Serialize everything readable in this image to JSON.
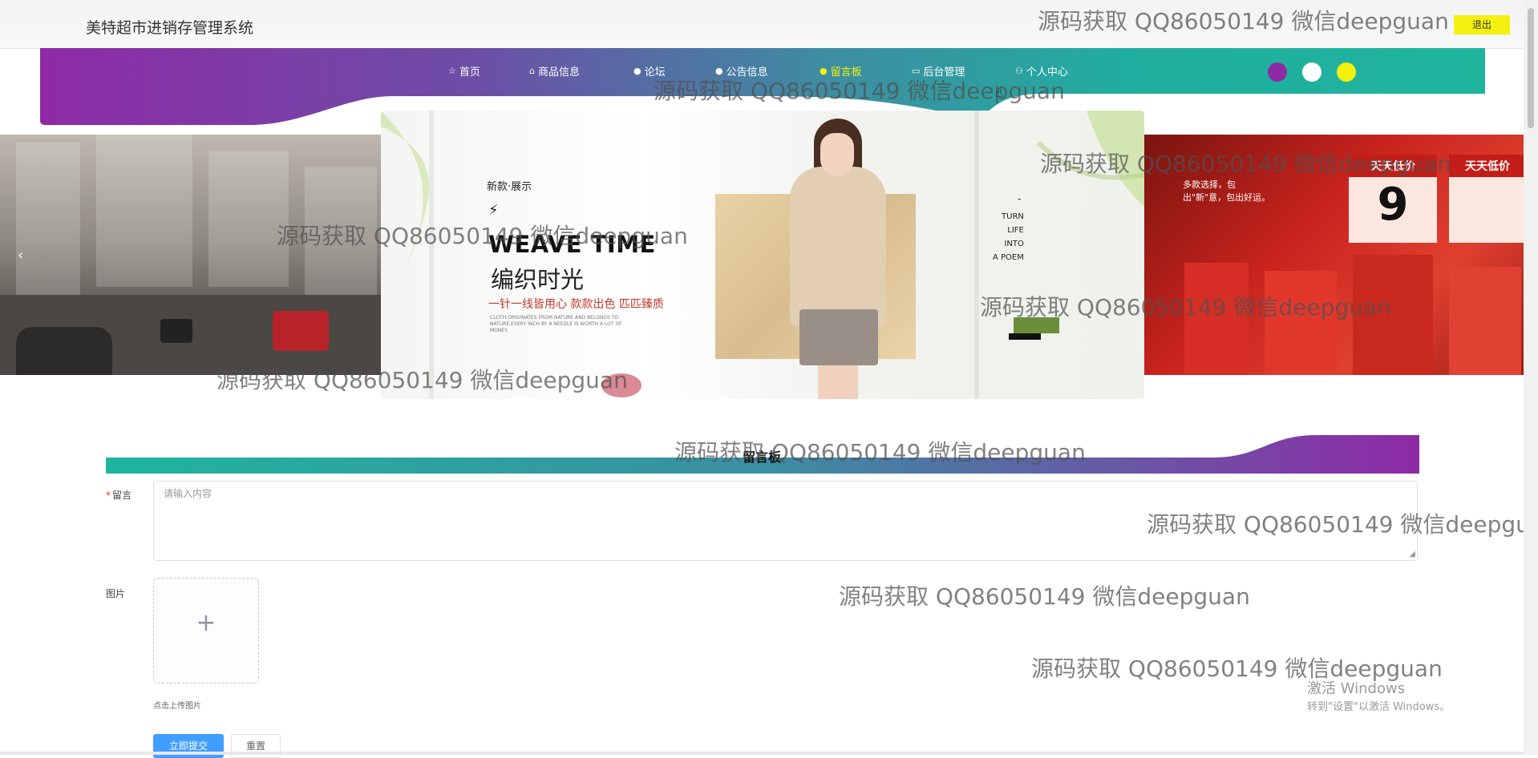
{
  "header": {
    "app_title": "美特超市进销存管理系统",
    "logout_label": "退出"
  },
  "nav": {
    "items": [
      {
        "label": "首页",
        "icon": "star-icon",
        "glyph": "☆"
      },
      {
        "label": "商品信息",
        "icon": "bag-icon",
        "glyph": "⌂"
      },
      {
        "label": "论坛",
        "icon": "info-icon",
        "glyph": "●"
      },
      {
        "label": "公告信息",
        "icon": "info-icon",
        "glyph": "●"
      },
      {
        "label": "留言板",
        "icon": "info-icon",
        "glyph": "●"
      },
      {
        "label": "后台管理",
        "icon": "briefcase-icon",
        "glyph": "▭"
      },
      {
        "label": "个人中心",
        "icon": "user-icon",
        "glyph": "⚇"
      }
    ],
    "active_item": "留言板"
  },
  "theme_swatches": [
    "#8e2aa6",
    "#ffffff",
    "#f4f010"
  ],
  "banner": {
    "kicker": "新款·展示",
    "headline": "WEAVE TIME",
    "headline_cn": "编织时光",
    "tagline": "一针一线皆用心 款款出色 匹匹臻质",
    "small_print": "CLOTH ORIGINATES FROM NATURE AND BELONGS TO NATURE.EVERY INCH BY A NEEDLE IS WORTH A LOT OF MONEY.",
    "poem_dash": "-",
    "poem_lines": [
      "TURN",
      "LIFE",
      "INTO",
      "A POEM"
    ],
    "right_slide_text_1": "天天低价",
    "right_slide_text_2": "9",
    "right_slide_text_3": "多款选择，包出\"新\"意，包出好运。",
    "prev_arrow": "‹"
  },
  "form": {
    "section_title": "留言板",
    "message_label": "留言",
    "message_placeholder": "请输入内容",
    "image_label": "图片",
    "upload_plus": "+",
    "upload_tip": "点击上传图片",
    "submit_label": "立即提交",
    "reset_label": "重置"
  },
  "watermark_text": "源码获取 QQ86050149 微信deepguan",
  "windows_notice": {
    "line1": "激活 Windows",
    "line2": "转到\"设置\"以激活 Windows。"
  },
  "colors": {
    "band_purple": "#8e2aa6",
    "band_teal": "#1fb59d",
    "accent_yellow": "#f4f010",
    "primary_blue": "#409eff"
  }
}
